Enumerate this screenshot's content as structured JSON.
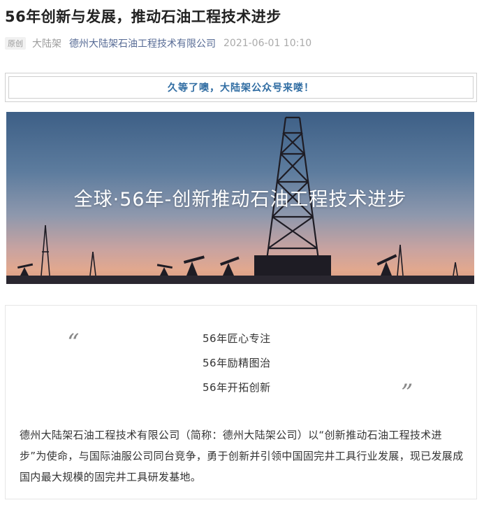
{
  "article": {
    "title": "56年创新与发展，推动石油工程技术进步",
    "original_badge": "原创",
    "account_name": "大陆架",
    "author": "德州大陆架石油工程技术有限公司",
    "publish_time": "2021-06-01 10:10"
  },
  "banner": {
    "text": "久等了噢，大陆架公众号来喽！",
    "color": "#2f6ca2"
  },
  "hero": {
    "caption": "全球·56年-创新推动石油工程技术进步"
  },
  "quote": {
    "open_mark": "“",
    "close_mark": "”",
    "lines": [
      "56年匠心专注",
      "56年励精图治",
      "56年开拓创新"
    ]
  },
  "body": {
    "paragraph": "德州大陆架石油工程技术有限公司（简称：德州大陆架公司）以“创新推动石油工程技术进步”为使命，与国际油服公司同台竞争，勇于创新并引领中国固完井工具行业发展，现已发展成国内最大规模的固完井工具研发基地。"
  },
  "colors": {
    "link": "#576b95",
    "muted": "#9b9b9b"
  }
}
